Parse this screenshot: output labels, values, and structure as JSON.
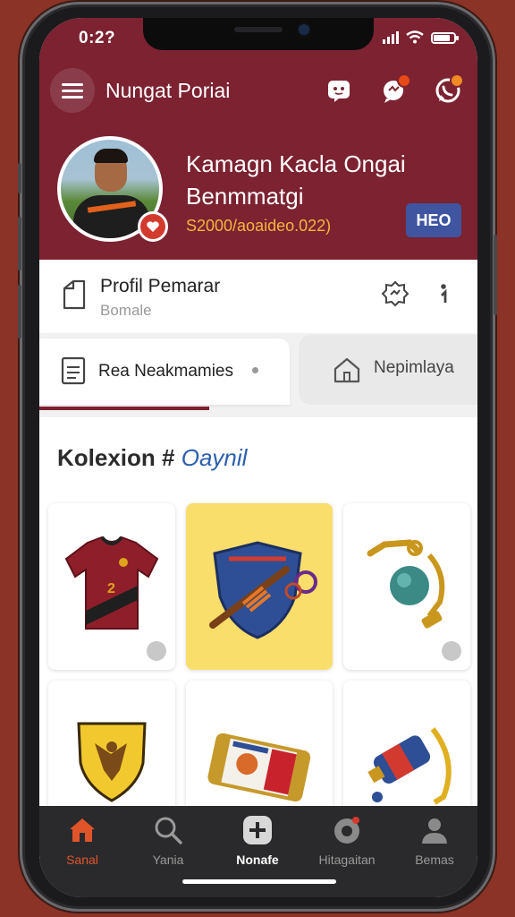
{
  "status_bar": {
    "time": "0:2?"
  },
  "header": {
    "app_title": "Nungat Poriai",
    "icons": [
      "chat-icon",
      "notification-icon",
      "whatsapp-icon"
    ]
  },
  "profile": {
    "name_line1": "Kamagn Kacla Ongai",
    "name_line2": "Benmmatgi",
    "subtitle": "S2000/aoaideo.022)",
    "tag": "HEO"
  },
  "profile_row": {
    "title": "Profil Pemarar",
    "subtitle": "Bomale"
  },
  "tabs": [
    {
      "label": "Rea Neakmamies"
    },
    {
      "label": "Nepimlaya"
    }
  ],
  "collection": {
    "title_prefix": "Kolexion #",
    "title_highlight": "Oaynil"
  },
  "bottom_nav": [
    {
      "label": "Sanal",
      "icon": "home-icon",
      "active": true
    },
    {
      "label": "Yania",
      "icon": "search-icon"
    },
    {
      "label": "Nonafe",
      "icon": "plus-icon"
    },
    {
      "label": "Hitagaitan",
      "icon": "camera-icon"
    },
    {
      "label": "Bemas",
      "icon": "profile-icon"
    }
  ],
  "colors": {
    "brand": "#7c2231",
    "accent": "#e0542a",
    "tag": "#3f55a0"
  }
}
